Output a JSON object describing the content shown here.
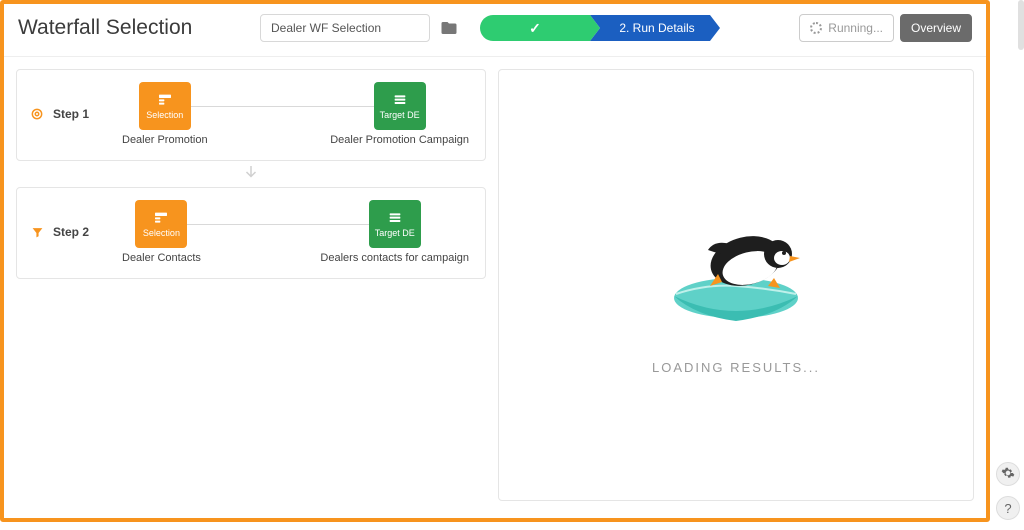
{
  "header": {
    "title": "Waterfall Selection",
    "selection_name": "Dealer WF Selection",
    "progress": {
      "step_active_label": "2. Run Details"
    },
    "running_label": "Running...",
    "overview_label": "Overview"
  },
  "steps": [
    {
      "label": "Step 1",
      "icon": "target",
      "selection_type": "Selection",
      "selection_name": "Dealer Promotion",
      "target_type": "Target DE",
      "target_name": "Dealer Promotion Campaign"
    },
    {
      "label": "Step 2",
      "icon": "filter",
      "selection_type": "Selection",
      "selection_name": "Dealer Contacts",
      "target_type": "Target DE",
      "target_name": "Dealers contacts for campaign"
    }
  ],
  "right": {
    "loading_text": "LOADING RESULTS..."
  },
  "colors": {
    "accent_orange": "#f7941e",
    "accent_green": "#2e9d4c",
    "progress_green": "#2ecc71",
    "progress_blue": "#1b5fc1"
  },
  "icons": {
    "folder": "folder-icon",
    "check": "check-icon",
    "target": "target-icon",
    "filter": "filter-icon",
    "selection_box": "selection-box-icon",
    "target_box": "target-de-icon",
    "arrow_down": "arrow-down-icon",
    "gear": "gear-icon",
    "help": "help-icon",
    "spinner": "spinner-icon"
  }
}
